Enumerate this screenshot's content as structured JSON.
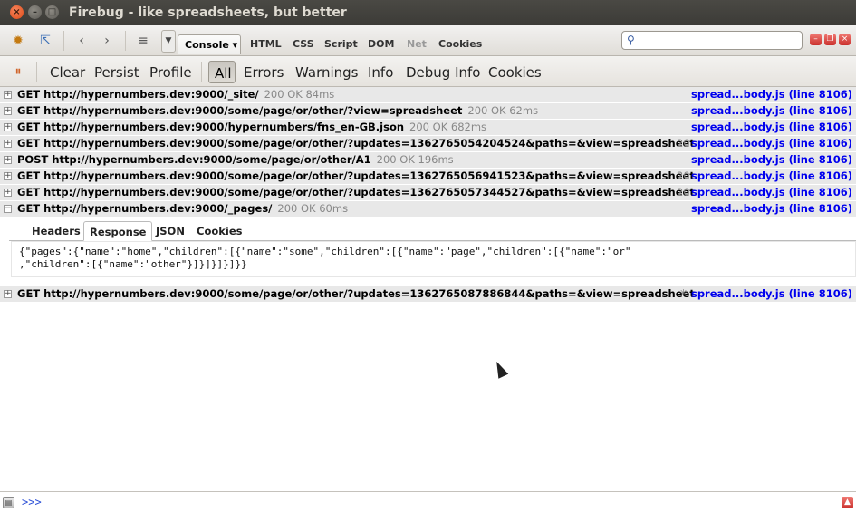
{
  "window": {
    "title": "Firebug - like spreadsheets, but better"
  },
  "toolbar": {
    "tabs": [
      "HTML",
      "CSS",
      "Script",
      "DOM",
      "Net",
      "Cookies"
    ],
    "console_tab": "Console",
    "search_placeholder": ""
  },
  "console_toolbar": {
    "buttons": [
      "Clear",
      "Persist",
      "Profile"
    ],
    "filters": [
      "All",
      "Errors",
      "Warnings",
      "Info",
      "Debug Info",
      "Cookies"
    ]
  },
  "log": [
    {
      "method": "GET",
      "url": "http://hypernumbers.dev:9000/_site/",
      "status": "200 OK 84ms",
      "source": "spread...body.js (line 8106)"
    },
    {
      "method": "GET",
      "url": "http://hypernumbers.dev:9000/some/page/or/other/?view=spreadsheet",
      "status": "200 OK 62ms",
      "source": "spread...body.js (line 8106)"
    },
    {
      "method": "GET",
      "url": "http://hypernumbers.dev:9000/hypernumbers/fns_en-GB.json",
      "status": "200 OK 682ms",
      "source": "spread...body.js (line 8106)"
    },
    {
      "method": "GET",
      "url": "http://hypernumbers.dev:9000/some/page/or/other/?updates=1362765054204524&paths=&view=spreadsheet",
      "status": "20",
      "source": "spread...body.js (line 8106)"
    },
    {
      "method": "POST",
      "url": "http://hypernumbers.dev:9000/some/page/or/other/A1",
      "status": "200 OK 196ms",
      "source": "spread...body.js (line 8106)"
    },
    {
      "method": "GET",
      "url": "http://hypernumbers.dev:9000/some/page/or/other/?updates=1362765056941523&paths=&view=spreadsheet",
      "status": "20",
      "source": "spread...body.js (line 8106)"
    },
    {
      "method": "GET",
      "url": "http://hypernumbers.dev:9000/some/page/or/other/?updates=1362765057344527&paths=&view=spreadsheet",
      "status": "20",
      "source": "spread...body.js (line 8106)"
    },
    {
      "method": "GET",
      "url": "http://hypernumbers.dev:9000/_pages/",
      "status": "200 OK 60ms",
      "source": "spread...body.js (line 8106)"
    }
  ],
  "detail": {
    "tabs": [
      "Headers",
      "Response",
      "JSON",
      "Cookies"
    ],
    "response_line1": "{\"pages\":{\"name\":\"home\",\"children\":[{\"name\":\"some\",\"children\":[{\"name\":\"page\",\"children\":[{\"name\":\"or\"",
    "response_line2": ",\"children\":[{\"name\":\"other\"}]}]}]}]}}"
  },
  "pending": {
    "method": "GET",
    "url": "http://hypernumbers.dev:9000/some/page/or/other/?updates=1362765087886844&paths=&view=spreadsheet",
    "source": "spread...body.js (line 8106)"
  },
  "command_line": {
    "prompt": ">>>"
  }
}
